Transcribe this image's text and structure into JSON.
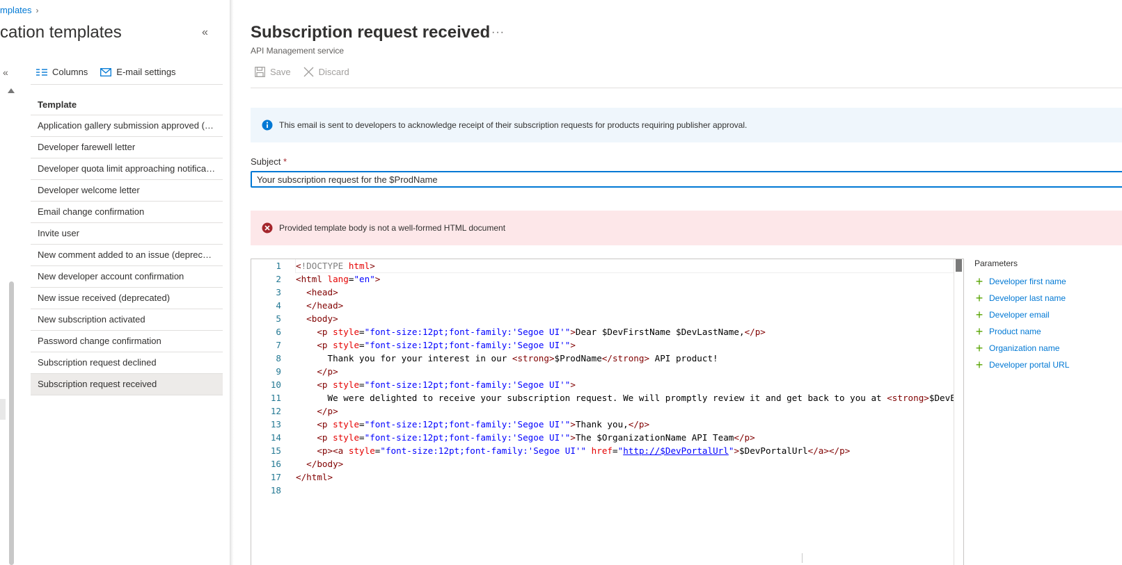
{
  "breadcrumb": {
    "text": "mplates"
  },
  "left_pane": {
    "title": "cation templates",
    "toolbar": {
      "columns_label": "Columns",
      "email_settings_label": "E-mail settings"
    },
    "list_header": "Template",
    "templates": [
      {
        "label": "Application gallery submission approved (de..."
      },
      {
        "label": "Developer farewell letter"
      },
      {
        "label": "Developer quota limit approaching notificati..."
      },
      {
        "label": "Developer welcome letter"
      },
      {
        "label": "Email change confirmation"
      },
      {
        "label": "Invite user"
      },
      {
        "label": "New comment added to an issue (deprecate..."
      },
      {
        "label": "New developer account confirmation"
      },
      {
        "label": "New issue received (deprecated)"
      },
      {
        "label": "New subscription activated"
      },
      {
        "label": "Password change confirmation"
      },
      {
        "label": "Subscription request declined"
      },
      {
        "label": "Subscription request received"
      }
    ],
    "selected_index": 12
  },
  "main": {
    "title": "Subscription request received",
    "more_label": "···",
    "subtitle": "API Management service",
    "commands": {
      "save_label": "Save",
      "discard_label": "Discard"
    },
    "info_message": "This email is sent to developers to acknowledge receipt of their subscription requests for products requiring publisher approval.",
    "subject": {
      "label": "Subject",
      "required_mark": "*",
      "value": "Your subscription request for the $ProdName"
    },
    "error_message": "Provided template body is not a well-formed HTML document",
    "editor": {
      "line_numbers": [
        "1",
        "2",
        "3",
        "4",
        "5",
        "6",
        "7",
        "8",
        "9",
        "10",
        "11",
        "12",
        "13",
        "14",
        "15",
        "16",
        "17",
        "18"
      ]
    },
    "parameters": {
      "title": "Parameters",
      "items": [
        {
          "label": "Developer first name"
        },
        {
          "label": "Developer last name"
        },
        {
          "label": "Developer email"
        },
        {
          "label": "Product name"
        },
        {
          "label": "Organization name"
        },
        {
          "label": "Developer portal URL"
        }
      ]
    }
  },
  "colors": {
    "accent": "#0078d4",
    "error": "#a4262c",
    "info_bg": "#eff6fc",
    "error_bg": "#fde7e9",
    "plus_green": "#57a300"
  },
  "icons": {
    "columns": "columns-icon",
    "email": "mail-icon",
    "save": "save-icon",
    "discard": "close-icon",
    "info": "info-icon",
    "error": "error-circle-icon",
    "add": "plus-icon"
  }
}
